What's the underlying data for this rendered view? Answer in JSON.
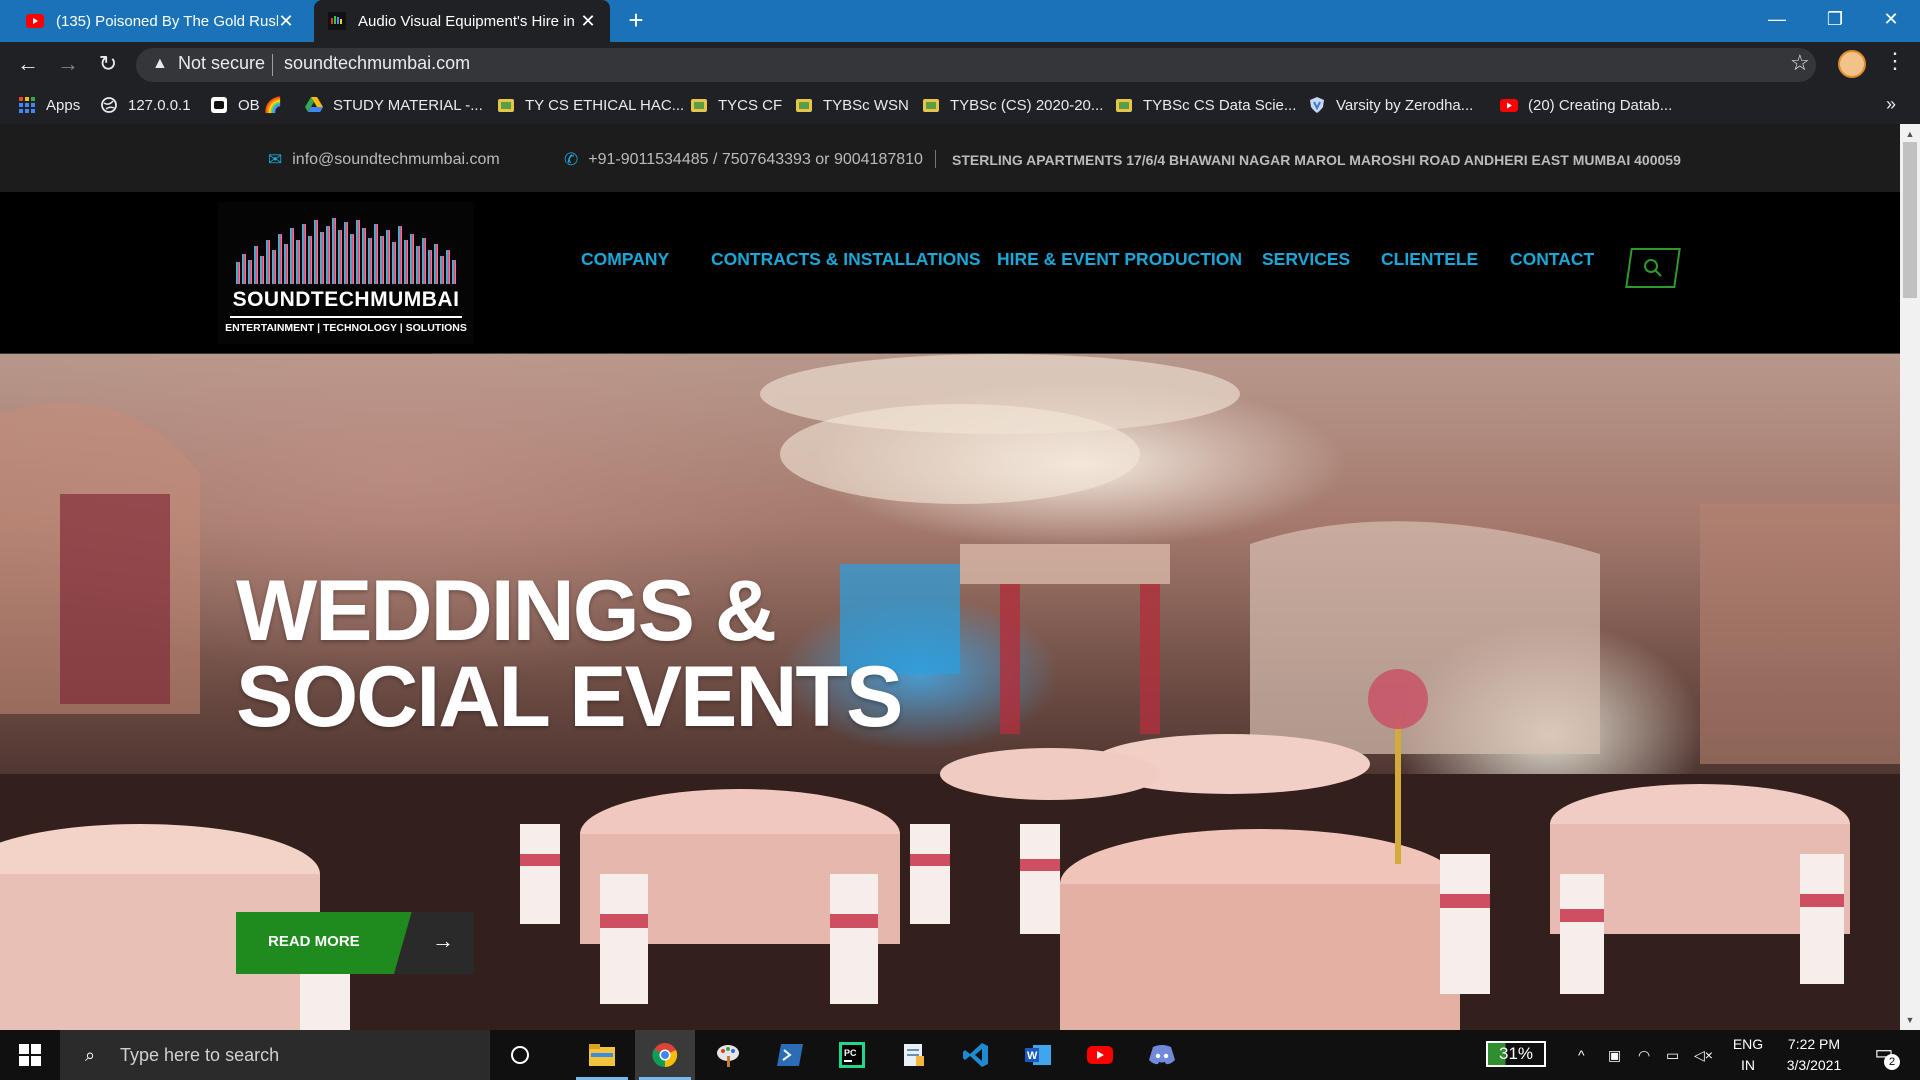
{
  "browser": {
    "tabs": [
      {
        "title": "(135) Poisoned By The Gold Rush",
        "favicon": "youtube-icon",
        "active": false
      },
      {
        "title": "Audio Visual Equipment's Hire in",
        "favicon": "site-favicon",
        "active": true
      }
    ],
    "security_label": "Not secure",
    "url": "soundtechmumbai.com",
    "bookmarks": [
      {
        "label": "Apps",
        "icon": "apps-grid-icon"
      },
      {
        "label": "127.0.0.1",
        "icon": "globe-icon"
      },
      {
        "label": "OB 🌈",
        "icon": "ob-icon"
      },
      {
        "label": "STUDY MATERIAL -...",
        "icon": "drive-icon"
      },
      {
        "label": "TY CS ETHICAL HAC...",
        "icon": "classroom-icon"
      },
      {
        "label": "TYCS CF",
        "icon": "classroom-icon"
      },
      {
        "label": "TYBSc WSN",
        "icon": "classroom-icon"
      },
      {
        "label": "TYBSc (CS) 2020-20...",
        "icon": "classroom-icon"
      },
      {
        "label": "TYBSc CS Data Scie...",
        "icon": "classroom-icon"
      },
      {
        "label": "Varsity by Zerodha...",
        "icon": "shield-icon"
      },
      {
        "label": "(20) Creating Datab...",
        "icon": "youtube-icon"
      }
    ],
    "more_bookmarks": "»"
  },
  "site": {
    "topbar": {
      "email": "info@soundtechmumbai.com",
      "phone": "+91-9011534485 / 7507643393 or 9004187810",
      "address": "STERLING APARTMENTS 17/6/4 BHAWANI NAGAR MAROL MAROSHI ROAD ANDHERI EAST MUMBAI 400059"
    },
    "logo": {
      "name": "SOUNDTECHMUMBAI",
      "tagline": "ENTERTAINMENT | TECHNOLOGY | SOLUTIONS"
    },
    "nav": [
      "COMPANY",
      "CONTRACTS & INSTALLATIONS",
      "HIRE & EVENT PRODUCTION",
      "SERVICES",
      "CLIENTELE",
      "CONTACT"
    ],
    "hero": {
      "title_line1": "WEDDINGS &",
      "title_line2": "SOCIAL EVENTS",
      "cta": "READ MORE"
    },
    "colors": {
      "nav": "#19a8d8",
      "cta": "#1f8a1e",
      "topbar_bg": "#1c1c1c"
    }
  },
  "taskbar": {
    "search_placeholder": "Type here to search",
    "battery": "31%",
    "language": [
      "ENG",
      "IN"
    ],
    "time": "7:22 PM",
    "date": "3/3/2021",
    "notifications": "2",
    "apps": [
      "cortana-icon",
      "file-explorer-icon",
      "chrome-icon",
      "paint-icon",
      "powershell-icon",
      "pycharm-icon",
      "notepad-icon",
      "vscode-icon",
      "word-icon",
      "youtube-icon",
      "discord-icon"
    ]
  }
}
